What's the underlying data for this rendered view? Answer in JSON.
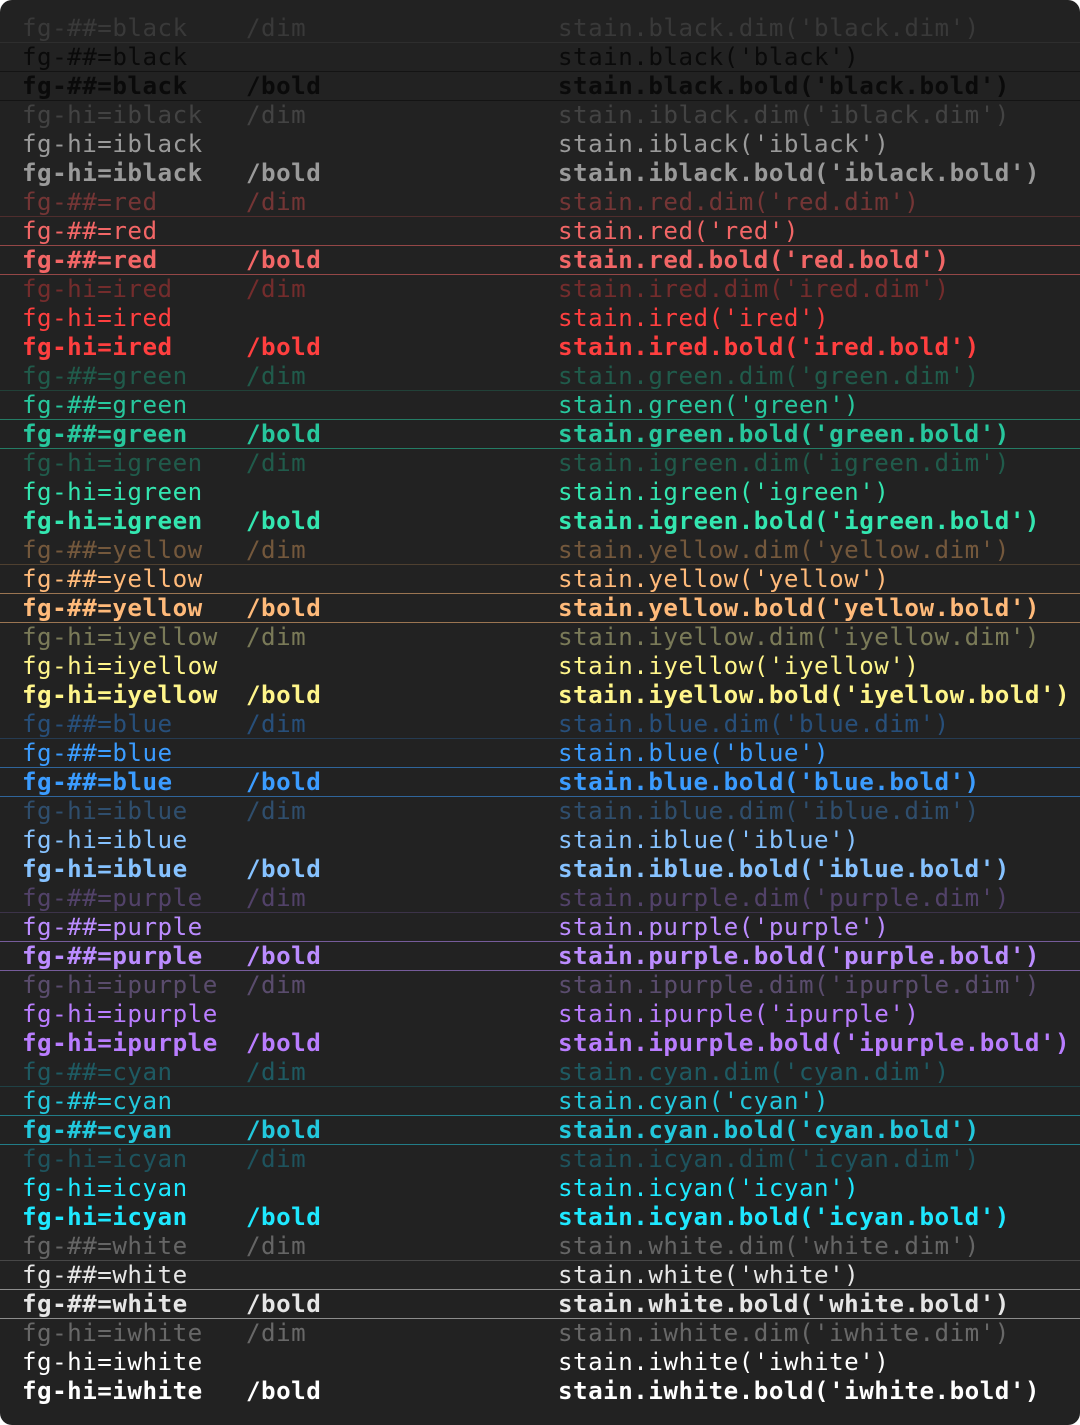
{
  "terminal": {
    "rows": [
      {
        "fg": "fg-##=black",
        "mod": "/dim",
        "code": "stain.black.dim('black.dim')",
        "color": "#555555",
        "style": "dim"
      },
      {
        "fg": "fg-##=black",
        "mod": "",
        "code": "stain.black('black')",
        "color": "#0a0a0a",
        "style": "normal"
      },
      {
        "fg": "fg-##=black",
        "mod": "/bold",
        "code": "stain.black.bold('black.bold')",
        "color": "#0a0a0a",
        "style": "bold"
      },
      {
        "fg": "fg-hi=iblack",
        "mod": "/dim",
        "code": "stain.iblack.dim('iblack.dim')",
        "color": "#6b6b6b",
        "style": "dim"
      },
      {
        "fg": "fg-hi=iblack",
        "mod": "",
        "code": "stain.iblack('iblack')",
        "color": "#9a9a9a",
        "style": "normal"
      },
      {
        "fg": "fg-hi=iblack",
        "mod": "/bold",
        "code": "stain.iblack.bold('iblack.bold')",
        "color": "#9a9a9a",
        "style": "bold"
      },
      {
        "fg": "fg-##=red",
        "mod": "/dim",
        "code": "stain.red.dim('red.dim')",
        "color": "#d94e4e",
        "style": "dim"
      },
      {
        "fg": "fg-##=red",
        "mod": "",
        "code": "stain.red('red')",
        "color": "#f26666",
        "style": "normal"
      },
      {
        "fg": "fg-##=red",
        "mod": "/bold",
        "code": "stain.red.bold('red.bold')",
        "color": "#f26666",
        "style": "bold"
      },
      {
        "fg": "fg-hi=ired",
        "mod": "/dim",
        "code": "stain.ired.dim('ired.dim')",
        "color": "#d83a3a",
        "style": "dim"
      },
      {
        "fg": "fg-hi=ired",
        "mod": "",
        "code": "stain.ired('ired')",
        "color": "#ff3f3f",
        "style": "normal"
      },
      {
        "fg": "fg-hi=ired",
        "mod": "/bold",
        "code": "stain.ired.bold('ired.bold')",
        "color": "#ff3f3f",
        "style": "bold"
      },
      {
        "fg": "fg-##=green",
        "mod": "/dim",
        "code": "stain.green.dim('green.dim')",
        "color": "#1fa07e",
        "style": "dim"
      },
      {
        "fg": "fg-##=green",
        "mod": "",
        "code": "stain.green('green')",
        "color": "#27c79d",
        "style": "normal"
      },
      {
        "fg": "fg-##=green",
        "mod": "/bold",
        "code": "stain.green.bold('green.bold')",
        "color": "#27c79d",
        "style": "bold"
      },
      {
        "fg": "fg-hi=igreen",
        "mod": "/dim",
        "code": "stain.igreen.dim('igreen.dim')",
        "color": "#1fa07e",
        "style": "dim"
      },
      {
        "fg": "fg-hi=igreen",
        "mod": "",
        "code": "stain.igreen('igreen')",
        "color": "#33e6b0",
        "style": "normal"
      },
      {
        "fg": "fg-hi=igreen",
        "mod": "/bold",
        "code": "stain.igreen.bold('igreen.bold')",
        "color": "#33e6b0",
        "style": "bold"
      },
      {
        "fg": "fg-##=yellow",
        "mod": "/dim",
        "code": "stain.yellow.dim('yellow.dim')",
        "color": "#d79a5c",
        "style": "dim"
      },
      {
        "fg": "fg-##=yellow",
        "mod": "",
        "code": "stain.yellow('yellow')",
        "color": "#ffba7a",
        "style": "normal"
      },
      {
        "fg": "fg-##=yellow",
        "mod": "/bold",
        "code": "stain.yellow.bold('yellow.bold')",
        "color": "#ffba7a",
        "style": "bold"
      },
      {
        "fg": "fg-hi=iyellow",
        "mod": "/dim",
        "code": "stain.iyellow.dim('iyellow.dim')",
        "color": "#e6e69a",
        "style": "dim"
      },
      {
        "fg": "fg-hi=iyellow",
        "mod": "",
        "code": "stain.iyellow('iyellow')",
        "color": "#fff58a",
        "style": "normal"
      },
      {
        "fg": "fg-hi=iyellow",
        "mod": "/bold",
        "code": "stain.iyellow.bold('iyellow.bold')",
        "color": "#fff58a",
        "style": "bold"
      },
      {
        "fg": "fg-##=blue",
        "mod": "/dim",
        "code": "stain.blue.dim('blue.dim')",
        "color": "#2f86e6",
        "style": "dim"
      },
      {
        "fg": "fg-##=blue",
        "mod": "",
        "code": "stain.blue('blue')",
        "color": "#3b9cff",
        "style": "normal"
      },
      {
        "fg": "fg-##=blue",
        "mod": "/bold",
        "code": "stain.blue.bold('blue.bold')",
        "color": "#3b9cff",
        "style": "bold"
      },
      {
        "fg": "fg-hi=iblue",
        "mod": "/dim",
        "code": "stain.iblue.dim('iblue.dim')",
        "color": "#3f85c9",
        "style": "dim"
      },
      {
        "fg": "fg-hi=iblue",
        "mod": "",
        "code": "stain.iblue('iblue')",
        "color": "#86c2ff",
        "style": "normal"
      },
      {
        "fg": "fg-hi=iblue",
        "mod": "/bold",
        "code": "stain.iblue.bold('iblue.bold')",
        "color": "#86c2ff",
        "style": "bold"
      },
      {
        "fg": "fg-##=purple",
        "mod": "/dim",
        "code": "stain.purple.dim('purple.dim')",
        "color": "#8c6abf",
        "style": "dim"
      },
      {
        "fg": "fg-##=purple",
        "mod": "",
        "code": "stain.purple('purple')",
        "color": "#bb8cff",
        "style": "normal"
      },
      {
        "fg": "fg-##=purple",
        "mod": "/bold",
        "code": "stain.purple.bold('purple.bold')",
        "color": "#bb8cff",
        "style": "bold"
      },
      {
        "fg": "fg-hi=ipurple",
        "mod": "/dim",
        "code": "stain.ipurple.dim('ipurple.dim')",
        "color": "#9f80c9",
        "style": "dim"
      },
      {
        "fg": "fg-hi=ipurple",
        "mod": "",
        "code": "stain.ipurple('ipurple')",
        "color": "#b97dff",
        "style": "normal"
      },
      {
        "fg": "fg-hi=ipurple",
        "mod": "/bold",
        "code": "stain.ipurple.bold('ipurple.bold')",
        "color": "#b97dff",
        "style": "bold"
      },
      {
        "fg": "fg-##=cyan",
        "mod": "/dim",
        "code": "stain.cyan.dim('cyan.dim')",
        "color": "#1a9fb0",
        "style": "dim"
      },
      {
        "fg": "fg-##=cyan",
        "mod": "",
        "code": "stain.cyan('cyan')",
        "color": "#22c8dd",
        "style": "normal"
      },
      {
        "fg": "fg-##=cyan",
        "mod": "/bold",
        "code": "stain.cyan.bold('cyan.bold')",
        "color": "#22c8dd",
        "style": "bold"
      },
      {
        "fg": "fg-hi=icyan",
        "mod": "/dim",
        "code": "stain.icyan.dim('icyan.dim')",
        "color": "#1a8fa5",
        "style": "dim"
      },
      {
        "fg": "fg-hi=icyan",
        "mod": "",
        "code": "stain.icyan('icyan')",
        "color": "#1ee8ff",
        "style": "normal"
      },
      {
        "fg": "fg-hi=icyan",
        "mod": "/bold",
        "code": "stain.icyan.bold('icyan.bold')",
        "color": "#1ee8ff",
        "style": "bold"
      },
      {
        "fg": "fg-##=white",
        "mod": "/dim",
        "code": "stain.white.dim('white.dim')",
        "color": "#b8b8b8",
        "style": "dim"
      },
      {
        "fg": "fg-##=white",
        "mod": "",
        "code": "stain.white('white')",
        "color": "#e6e6e6",
        "style": "normal"
      },
      {
        "fg": "fg-##=white",
        "mod": "/bold",
        "code": "stain.white.bold('white.bold')",
        "color": "#e6e6e6",
        "style": "bold"
      },
      {
        "fg": "fg-hi=iwhite",
        "mod": "/dim",
        "code": "stain.iwhite.dim('iwhite.dim')",
        "color": "#bdbdbd",
        "style": "dim"
      },
      {
        "fg": "fg-hi=iwhite",
        "mod": "",
        "code": "stain.iwhite('iwhite')",
        "color": "#ffffff",
        "style": "normal"
      },
      {
        "fg": "fg-hi=iwhite",
        "mod": "/bold",
        "code": "stain.iwhite.bold('iwhite.bold')",
        "color": "#ffffff",
        "style": "bold"
      }
    ],
    "underlined_colors": [
      "black",
      "red",
      "green",
      "yellow",
      "blue",
      "purple",
      "cyan",
      "white"
    ]
  }
}
